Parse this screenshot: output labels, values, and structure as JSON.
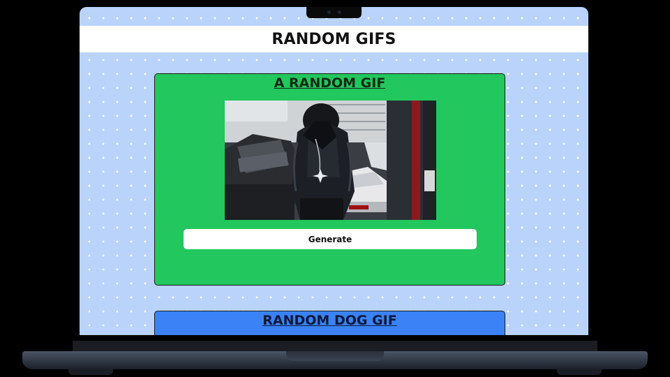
{
  "page": {
    "title": "RANDOM GIFS"
  },
  "random_gif_card": {
    "title": "A RANDOM GIF",
    "generate_label": "Generate",
    "color": "#22c75e"
  },
  "random_dog_gif_card": {
    "title": "RANDOM DOG GIF",
    "color": "#3b82f6"
  },
  "icons": {
    "gif_image": "hooded-figure-in-garage-image"
  }
}
